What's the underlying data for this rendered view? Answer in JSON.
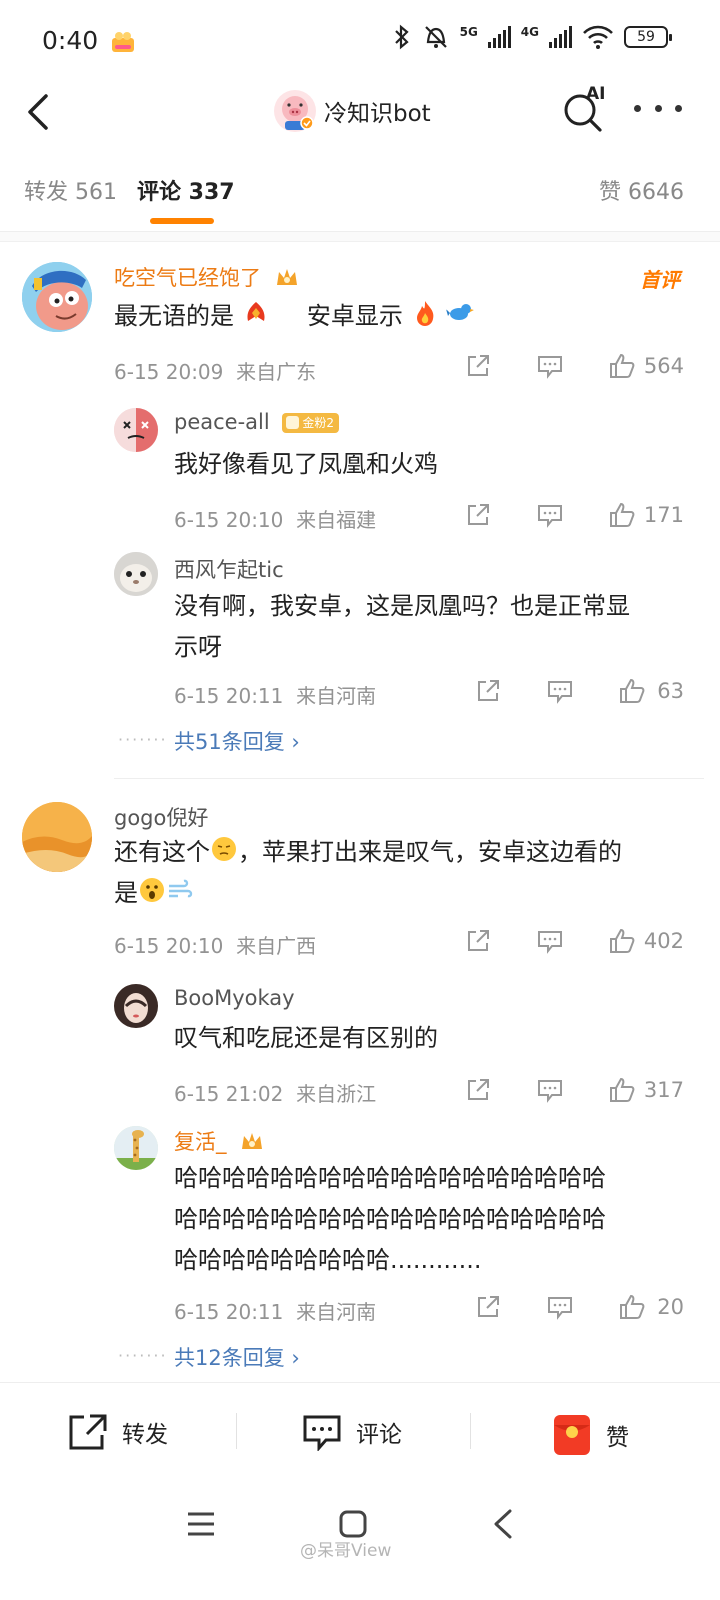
{
  "status_bar": {
    "time": "0:40",
    "network_5g": "5G",
    "network_4g": "4G",
    "battery": "59"
  },
  "nav": {
    "title": "冷知识bot",
    "ai_label": "AI"
  },
  "tabs": {
    "repost": "转发 561",
    "comment": "评论 337",
    "likes": "赞 6646"
  },
  "comments": [
    {
      "user": "吃空气已经饱了",
      "tag": "首评",
      "text_a": "最无语的是",
      "text_b": "安卓显示",
      "time": "6-15 20:09",
      "location": "来自广东",
      "likes": "564",
      "replies": [
        {
          "user": "peace-all",
          "badge": "金粉2",
          "text": "我好像看见了凤凰和火鸡",
          "time": "6-15 20:10",
          "location": "来自福建",
          "likes": "171"
        },
        {
          "user": "西风乍起tic",
          "text_line1": "没有啊，我安卓，这是凤凰吗？也是正常显",
          "text_line2": "示呀",
          "time": "6-15 20:11",
          "location": "来自河南",
          "likes": "63"
        }
      ],
      "more_replies": "共51条回复"
    },
    {
      "user": "gogo倪好",
      "text_a": "还有这个",
      "text_b": "，苹果打出来是叹气，安卓这边看的",
      "text_c": "是",
      "time": "6-15 20:10",
      "location": "来自广西",
      "likes": "402",
      "replies": [
        {
          "user": "BooMyokay",
          "text": "叹气和吃屁还是有区别的",
          "time": "6-15 21:02",
          "location": "来自浙江",
          "likes": "317"
        },
        {
          "user": "复活_",
          "text_line1": "哈哈哈哈哈哈哈哈哈哈哈哈哈哈哈哈哈哈",
          "text_line2": "哈哈哈哈哈哈哈哈哈哈哈哈哈哈哈哈哈哈",
          "text_line3": "哈哈哈哈哈哈哈哈哈............",
          "time": "6-15 20:11",
          "location": "来自河南",
          "likes": "20"
        }
      ],
      "more_replies": "共12条回复"
    }
  ],
  "bottom_bar": {
    "repost": "转发",
    "comment": "评论",
    "like": "赞"
  },
  "watermark": "@呆哥View",
  "colors": {
    "accent": "#ff8200",
    "link": "#4a7ab8",
    "vip_name": "#ec7b14",
    "meta": "#939393"
  }
}
